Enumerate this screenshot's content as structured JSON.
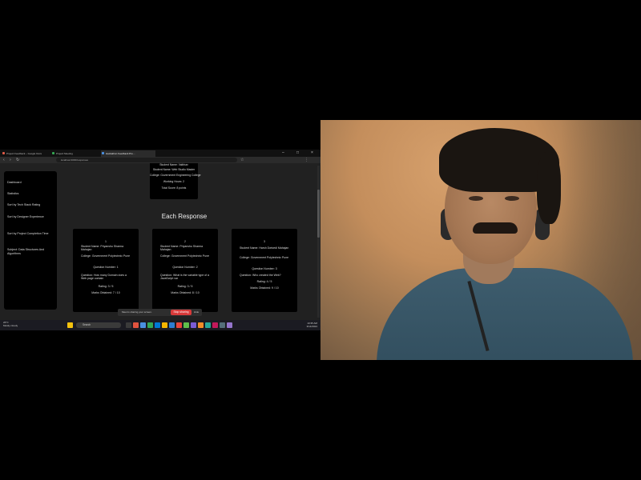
{
  "browser": {
    "tabs": [
      {
        "label": "Project Feedback – Google Docs"
      },
      {
        "label": "Project Meeting"
      },
      {
        "label": "Hackathon Feedback Pro…",
        "active": true
      }
    ],
    "url": "localhost:3000/responses"
  },
  "sidebar": {
    "items": [
      {
        "label": "Dashboard"
      },
      {
        "label": "Statistics"
      },
      {
        "label": "Sort by Tech Stack Rating"
      },
      {
        "label": "Sort by Designer Experience"
      },
      {
        "label": "Sort by Project Completion Time"
      },
      {
        "label": "Subject: Data Structures And Algorithms"
      }
    ]
  },
  "top_card": {
    "lines": [
      "Student Name: Vaibhav",
      "Student Name: Web Studio Master",
      "College: Government Engineering College",
      "Working Hours: 2",
      "Total Score: 8 points"
    ]
  },
  "section_heading": "Each Response",
  "cards": [
    {
      "number": "1",
      "student": "Student Name: Priyanshu Sharma Mahajan",
      "college": "College: Government Polytechnic Pune",
      "question": "Question Number: 1",
      "answer": "Question: How many Domain does a Web page contain",
      "rating": "Rating: 3 / 5",
      "marks": "Marks Obtained: 7 / 10"
    },
    {
      "number": "2",
      "student": "Student Name: Priyanshu Sharma Mahajan",
      "college": "College: Government Polytechnic Pune",
      "question": "Question Number: 2",
      "answer": "Question: What is the variable type of a JavaScript var",
      "rating": "Rating: 3 / 5",
      "marks": "Marks Obtained: 8 / 10"
    },
    {
      "number": "3",
      "student": "Student Name: Harsh Dwivedi Mahajan",
      "college": "College: Government Polytechnic Pune",
      "question": "Question Number: 3",
      "answer": "Question: Who created the Web?",
      "rating": "Rating: 4 / 5",
      "marks": "Marks Obtained: 9 / 10"
    }
  ],
  "share_bar": {
    "text": "Meet is sharing your screen.",
    "stop_label": "Stop sharing",
    "hide_label": "Hide"
  },
  "taskbar": {
    "weather_temp": "26°C",
    "weather_desc": "Mostly cloudy",
    "search_placeholder": "Search",
    "time": "10:35 AM",
    "date": "3/14/2024",
    "lang": "ENG IN"
  },
  "colors": {
    "stop_button": "#d93a3a",
    "shirt": "#3e5d6e"
  }
}
